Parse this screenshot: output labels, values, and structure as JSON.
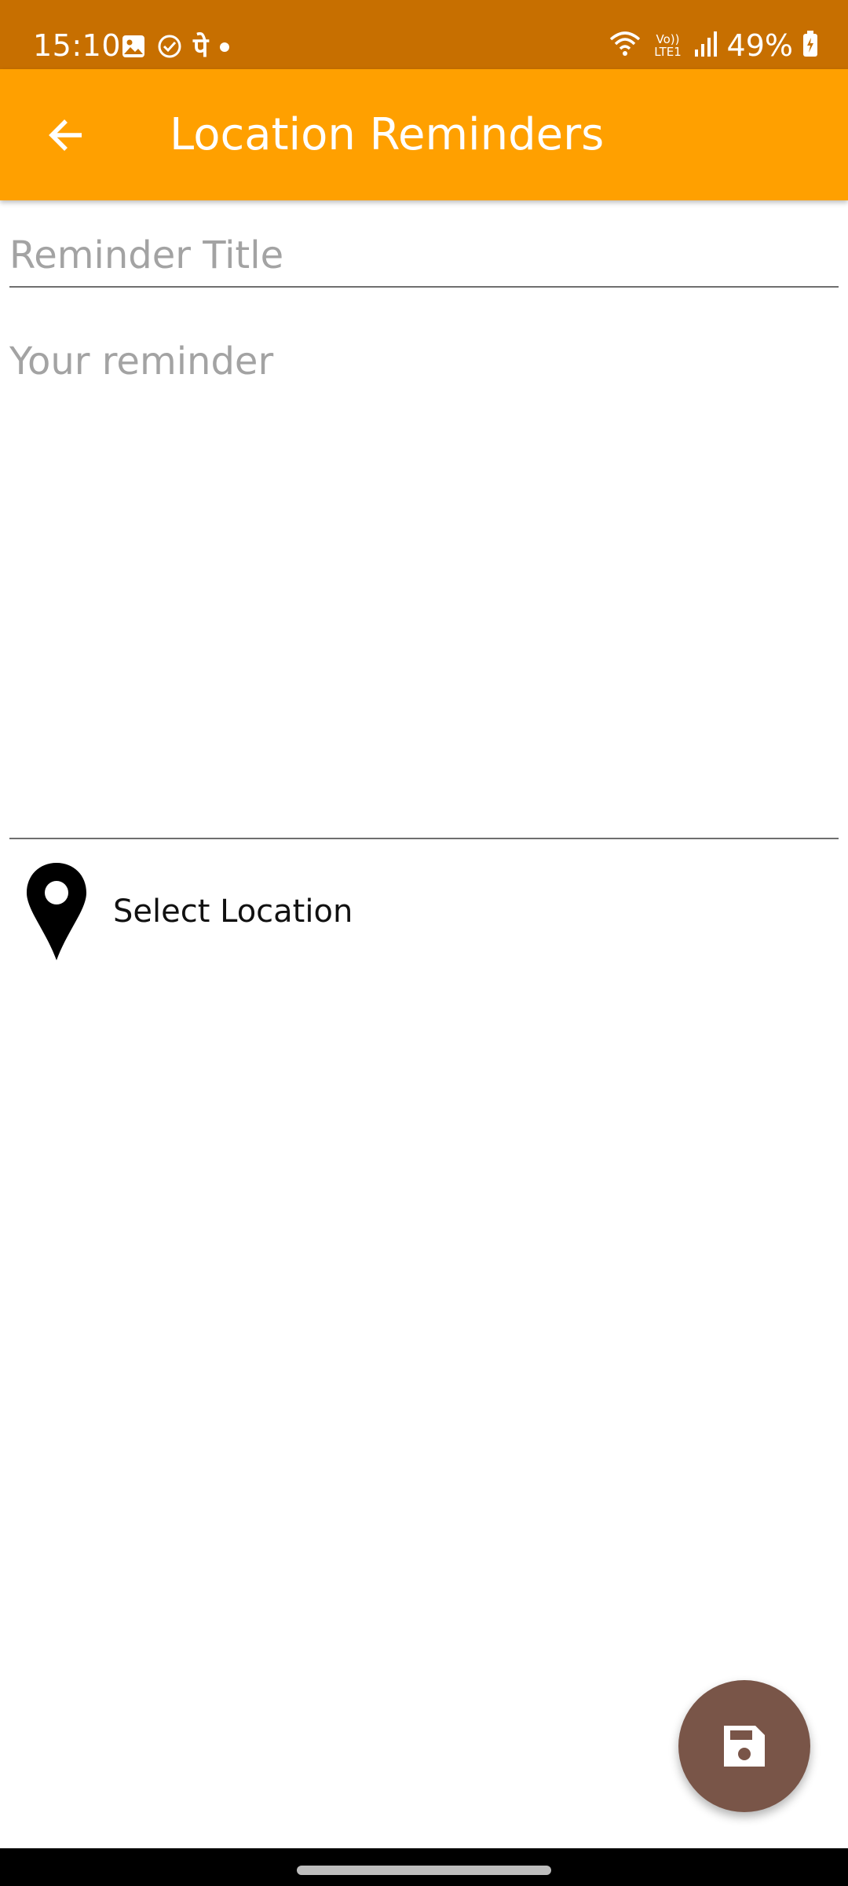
{
  "status_bar": {
    "time": "15:10",
    "battery": "49%",
    "left_icons": [
      "gallery-icon",
      "check-circle-icon",
      "phonepe-icon",
      "dot-icon"
    ],
    "right_icons": [
      "wifi-icon",
      "volte-icon",
      "signal-icon",
      "battery-icon"
    ],
    "volte_text": "Vo)) LTE1",
    "phonepe_glyph": "पे"
  },
  "app_bar": {
    "title": "Location Reminders",
    "back_icon": "arrow-left-icon",
    "background": "#ffa000"
  },
  "form": {
    "title_placeholder": "Reminder Title",
    "title_value": "",
    "description_placeholder": "Your reminder",
    "description_value": ""
  },
  "location": {
    "label": "Select Location",
    "icon": "map-pin-icon"
  },
  "fab": {
    "icon": "save-icon",
    "color": "#795548"
  },
  "colors": {
    "status_bar": "#c76f00",
    "accent": "#ffa000",
    "fab": "#795548"
  }
}
